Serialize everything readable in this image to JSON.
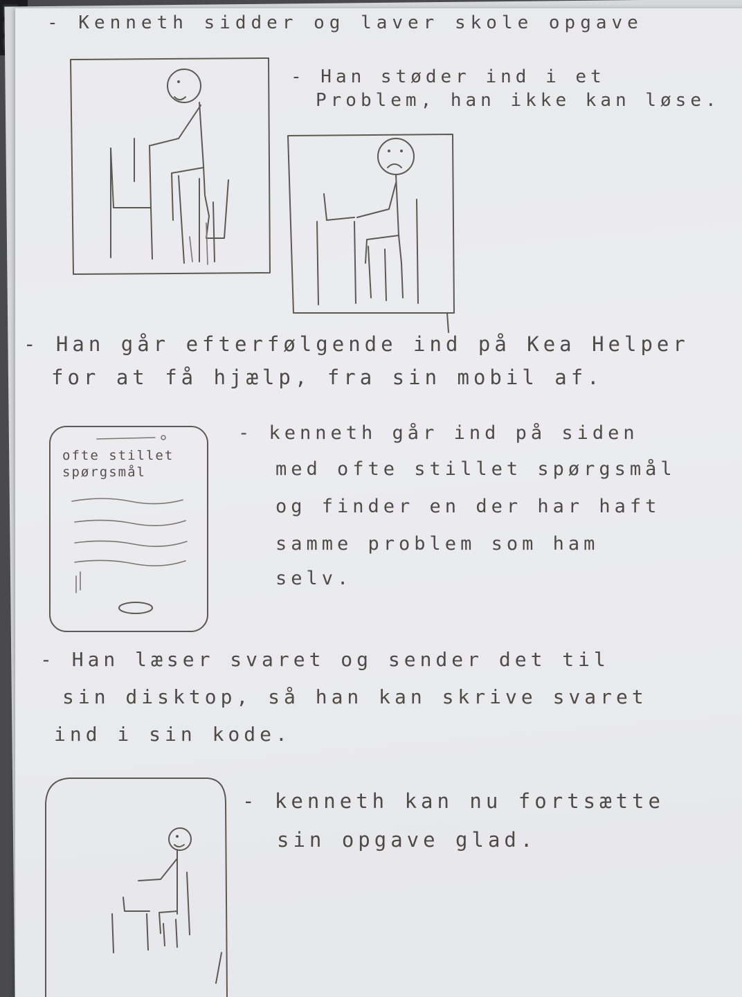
{
  "note": {
    "step1": "- Kenneth sidder og laver skole opgave",
    "step2": {
      "line1": "- Han støder ind i et",
      "line2": "Problem, han ikke kan løse."
    },
    "step3": {
      "line1": "- Han går efterfølgende ind på Kea Helper",
      "line2": "for at få hjælp, fra sin mobil af."
    },
    "phone": {
      "title_line1": "ofte stillet",
      "title_line2": "spørgsmål"
    },
    "step4": {
      "line1": "- kenneth går ind på siden",
      "line2": "med ofte stillet spørgsmål",
      "line3": "og finder en der har haft",
      "line4": "samme problem som ham",
      "line5": "selv."
    },
    "step5": {
      "line1": "- Han læser svaret og sender det til",
      "line2": "sin disktop, så han kan skrive svaret",
      "line3": "ind i sin kode."
    },
    "step6": {
      "line1": "- kenneth kan nu fortsætte",
      "line2": "sin opgave glad."
    }
  }
}
